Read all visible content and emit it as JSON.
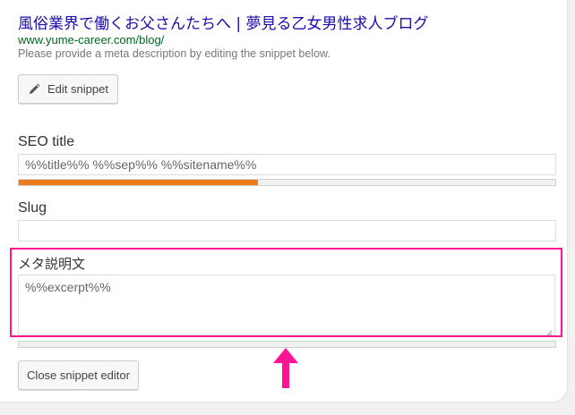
{
  "snippet_preview": {
    "title": "風俗業界で働くお父さんたちへ | 夢見る乙女男性求人ブログ",
    "url": "www.yume-career.com/blog/",
    "description": "Please provide a meta description by editing the snippet below."
  },
  "buttons": {
    "edit_snippet": "Edit snippet",
    "close_snippet_editor": "Close snippet editor"
  },
  "seo_title": {
    "label": "SEO title",
    "value": "%%title%% %%sep%% %%sitename%%",
    "progress": 0.445,
    "progress_color": "#ee7c1b"
  },
  "slug": {
    "label": "Slug",
    "value": ""
  },
  "meta_description": {
    "label": "メタ説明文",
    "value": "%%excerpt%%",
    "progress": 0
  },
  "annotation": {
    "highlight_color": "#ff1493",
    "arrow_color": "#ff1493",
    "arrow_direction": "up"
  },
  "icons": {
    "edit": "pencil-icon",
    "resize": "resize-handle-icon"
  }
}
